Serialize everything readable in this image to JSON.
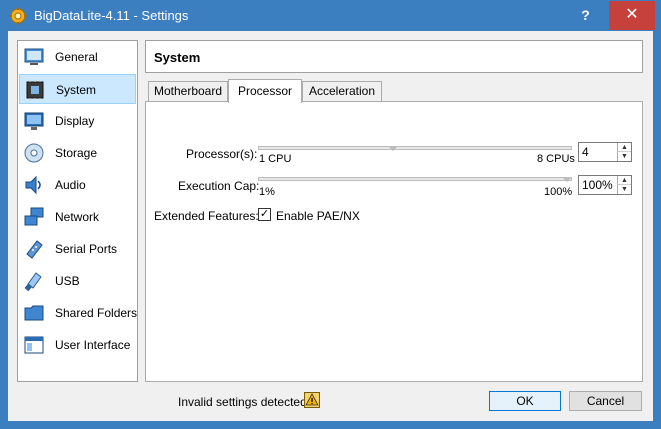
{
  "window": {
    "title": "BigDataLite-4.11 - Settings"
  },
  "titlebar_buttons": {
    "help": "?",
    "close": "✕"
  },
  "sidebar": {
    "items": [
      {
        "label": "General",
        "icon": "general-icon"
      },
      {
        "label": "System",
        "icon": "system-icon",
        "selected": true
      },
      {
        "label": "Display",
        "icon": "display-icon"
      },
      {
        "label": "Storage",
        "icon": "storage-icon"
      },
      {
        "label": "Audio",
        "icon": "audio-icon"
      },
      {
        "label": "Network",
        "icon": "network-icon"
      },
      {
        "label": "Serial Ports",
        "icon": "serial-ports-icon"
      },
      {
        "label": "USB",
        "icon": "usb-icon"
      },
      {
        "label": "Shared Folders",
        "icon": "shared-folders-icon"
      },
      {
        "label": "User Interface",
        "icon": "user-interface-icon"
      }
    ]
  },
  "header": {
    "title": "System"
  },
  "tabs": [
    {
      "label": "Motherboard"
    },
    {
      "label": "Processor",
      "active": true
    },
    {
      "label": "Acceleration"
    }
  ],
  "processor": {
    "processors": {
      "label": "Processor(s):",
      "min_label": "1 CPU",
      "max_label": "8 CPUs",
      "value": "4",
      "level": 4
    },
    "execution_cap": {
      "label": "Execution Cap:",
      "min_label": "1%",
      "max_label": "100%",
      "value": "100%",
      "level": 100
    },
    "extended_features": {
      "label": "Extended Features:",
      "checkbox_label": "Enable PAE/NX",
      "checked": true
    }
  },
  "footer": {
    "status": "Invalid settings detected",
    "ok_label": "OK",
    "cancel_label": "Cancel"
  },
  "colors": {
    "titlebar": "#3c7fc1",
    "close": "#c7413c",
    "selected": "#cce8ff",
    "accent": "#0078d7"
  }
}
